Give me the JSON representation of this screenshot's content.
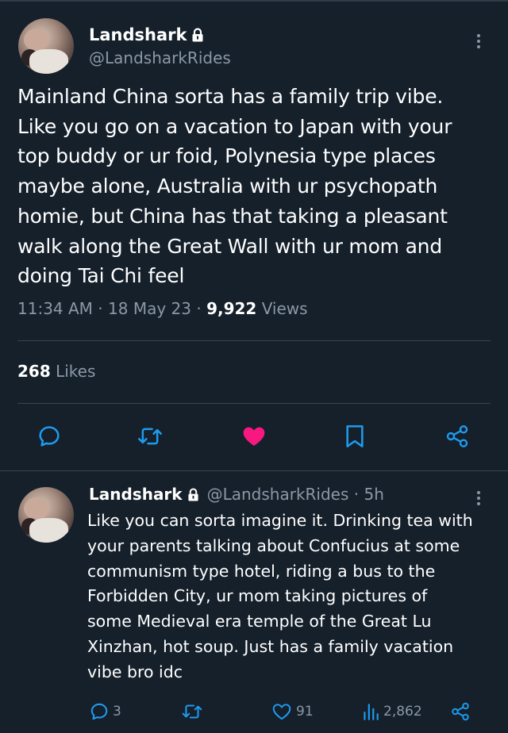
{
  "main_tweet": {
    "author": {
      "name": "Landshark",
      "handle": "@LandsharkRides"
    },
    "text": "Mainland China sorta has a family trip vibe.\nLike you go on a vacation to Japan with your\ntop buddy or ur foid, Polynesia type places\nmaybe alone, Australia with ur psychopath\nhomie, but China has that taking a pleasant\nwalk along the Great Wall with ur mom and\ndoing Tai Chi feel",
    "time": "11:34 AM",
    "date": "18 May 23",
    "separator": "·",
    "views_count": "9,922",
    "views_label": "Views",
    "likes_count": "268",
    "likes_label": "Likes"
  },
  "reply": {
    "author": {
      "name": "Landshark",
      "handle": "@LandsharkRides"
    },
    "age": "· 5h",
    "text": "Like you can sorta imagine it. Drinking tea with\nyour parents talking about Confucius at some\ncommunism type hotel, riding a bus to the\nForbidden City, ur mom taking pictures of\nsome Medieval era temple of the Great Lu\nXinzhan, hot soup. Just has a family vacation\nvibe bro idc",
    "reply_count": "3",
    "like_count": "91",
    "view_count": "2,862"
  },
  "colors": {
    "background": "#15202b",
    "muted_text": "#8b98a5",
    "accent_blue": "#1d9bf0",
    "like_pink": "#f91880",
    "divider": "#38444d"
  },
  "icons": [
    "lock-icon",
    "more-icon",
    "reply-icon",
    "retweet-icon",
    "heart-filled-icon",
    "bookmark-icon",
    "share-icon",
    "heart-outline-icon",
    "views-icon"
  ]
}
